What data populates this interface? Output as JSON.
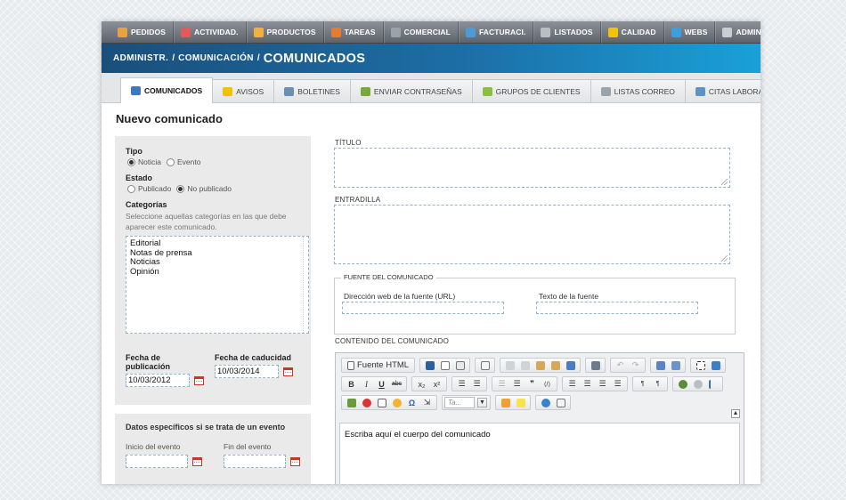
{
  "topnav": {
    "items": [
      {
        "label": "PEDIDOS",
        "icon": "orders-icon",
        "color": "#e8a33a"
      },
      {
        "label": "ACTIVIDAD.",
        "icon": "activity-icon",
        "color": "#e35a5a"
      },
      {
        "label": "PRODUCTOS",
        "icon": "products-icon",
        "color": "#f0b23c"
      },
      {
        "label": "TAREAS",
        "icon": "tasks-icon",
        "color": "#e87b2e"
      },
      {
        "label": "COMERCIAL",
        "icon": "commercial-icon",
        "color": "#9aa3aa"
      },
      {
        "label": "FACTURACI.",
        "icon": "billing-icon",
        "color": "#4e9ad6"
      },
      {
        "label": "LISTADOS",
        "icon": "listings-icon",
        "color": "#b7bec4"
      },
      {
        "label": "CALIDAD",
        "icon": "star-icon",
        "color": "#f5c400"
      },
      {
        "label": "WEBS",
        "icon": "globe-icon",
        "color": "#3aa0e0"
      },
      {
        "label": "ADMINISTR.",
        "icon": "gear-icon",
        "color": "#c9ced3"
      }
    ]
  },
  "breadcrumb": {
    "part1": "ADMINISTR.",
    "part2": "COMUNICACIÓN",
    "separator": "/",
    "current": "COMUNICADOS"
  },
  "tabs": [
    {
      "label": "COMUNICADOS",
      "icon": "megaphone-icon",
      "color": "#3a78c2",
      "active": true
    },
    {
      "label": "AVISOS",
      "icon": "warning-icon",
      "color": "#f2c200",
      "active": false
    },
    {
      "label": "BOLETINES",
      "icon": "newsletter-icon",
      "color": "#6a8fb3",
      "active": false
    },
    {
      "label": "ENVIAR CONTRASEÑAS",
      "icon": "users-key-icon",
      "color": "#79a83a",
      "active": false
    },
    {
      "label": "GRUPOS DE CLIENTES",
      "icon": "client-groups-icon",
      "color": "#8cbf3f",
      "active": false
    },
    {
      "label": "LISTAS CORREO",
      "icon": "mail-list-icon",
      "color": "#9aa3aa",
      "active": false
    },
    {
      "label": "CITAS LABORAL",
      "icon": "chat-icon",
      "color": "#5b93c7",
      "active": false
    }
  ],
  "page_title": "Nuevo comunicado",
  "left": {
    "tipo_label": "Tipo",
    "tipo_options": [
      {
        "label": "Noticia",
        "selected": true
      },
      {
        "label": "Evento",
        "selected": false
      }
    ],
    "estado_label": "Estado",
    "estado_options": [
      {
        "label": "Publicado",
        "selected": false
      },
      {
        "label": "No publicado",
        "selected": true
      }
    ],
    "categorias_label": "Categorías",
    "categorias_desc": "Seleccione aquellas categorías en las que debe aparecer este comunicado.",
    "categorias": [
      "Editorial",
      "Notas de prensa",
      "Noticias",
      "Opinión"
    ],
    "fecha_pub_label": "Fecha de publicación",
    "fecha_pub_value": "10/03/2012",
    "fecha_cad_label": "Fecha de caducidad",
    "fecha_cad_value": "10/03/2014"
  },
  "evento": {
    "title": "Datos específicos si se trata de un evento",
    "inicio_label": "Inicio del evento",
    "fin_label": "Fin del evento"
  },
  "right": {
    "titulo_label": "TÍTULO",
    "entradilla_label": "ENTRADILLA",
    "fuente_legend": "FUENTE DEL COMUNICADO",
    "fuente_url_label": "Dirección web de la fuente (URL)",
    "fuente_texto_label": "Texto de la fuente",
    "contenido_label": "CONTENIDO DEL COMUNICADO"
  },
  "editor": {
    "source_label": "Fuente HTML",
    "bold": "B",
    "italic": "I",
    "underline": "U",
    "strike": "abc",
    "subscript": "x₂",
    "superscript": "x²",
    "style_select": "Ta...",
    "collapse": "▲",
    "body_text": "Escriba aquí el cuerpo del comunicado"
  }
}
